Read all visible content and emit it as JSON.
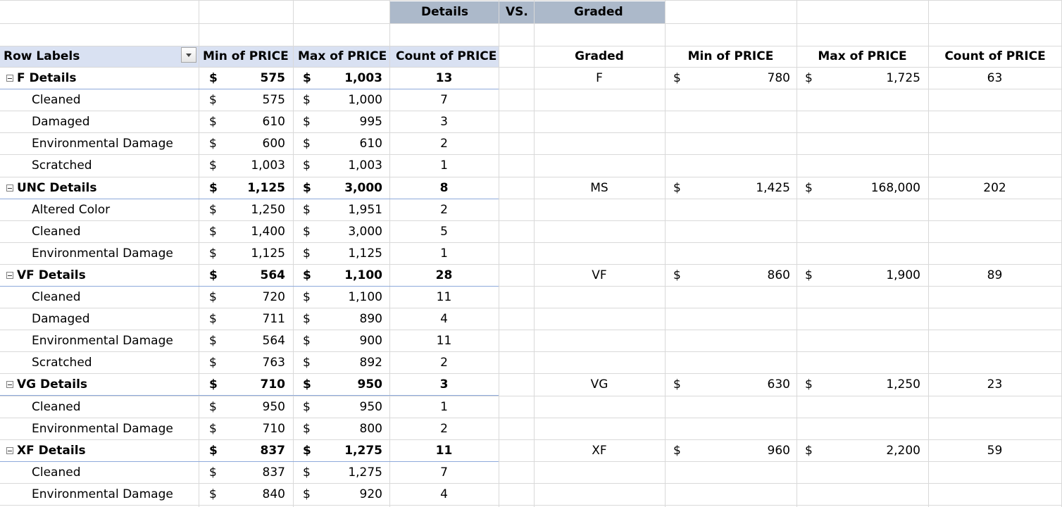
{
  "header": {
    "details": "Details",
    "vs": "VS.",
    "graded": "Graded"
  },
  "pivot_left": {
    "columns": [
      "Row Labels",
      "Min of PRICE",
      "Max of PRICE",
      "Count of PRICE"
    ],
    "currency": "$",
    "rows": [
      {
        "label": "F Details",
        "group": true,
        "min": "575",
        "max": "1,003",
        "count": "13"
      },
      {
        "label": "Cleaned",
        "group": false,
        "min": "575",
        "max": "1,000",
        "count": "7"
      },
      {
        "label": "Damaged",
        "group": false,
        "min": "610",
        "max": "995",
        "count": "3"
      },
      {
        "label": "Environmental Damage",
        "group": false,
        "min": "600",
        "max": "610",
        "count": "2"
      },
      {
        "label": "Scratched",
        "group": false,
        "min": "1,003",
        "max": "1,003",
        "count": "1"
      },
      {
        "label": "UNC Details",
        "group": true,
        "min": "1,125",
        "max": "3,000",
        "count": "8"
      },
      {
        "label": "Altered Color",
        "group": false,
        "min": "1,250",
        "max": "1,951",
        "count": "2"
      },
      {
        "label": "Cleaned",
        "group": false,
        "min": "1,400",
        "max": "3,000",
        "count": "5"
      },
      {
        "label": "Environmental Damage",
        "group": false,
        "min": "1,125",
        "max": "1,125",
        "count": "1"
      },
      {
        "label": "VF Details",
        "group": true,
        "min": "564",
        "max": "1,100",
        "count": "28"
      },
      {
        "label": "Cleaned",
        "group": false,
        "min": "720",
        "max": "1,100",
        "count": "11"
      },
      {
        "label": "Damaged",
        "group": false,
        "min": "711",
        "max": "890",
        "count": "4"
      },
      {
        "label": "Environmental Damage",
        "group": false,
        "min": "564",
        "max": "900",
        "count": "11"
      },
      {
        "label": "Scratched",
        "group": false,
        "min": "763",
        "max": "892",
        "count": "2"
      },
      {
        "label": "VG Details",
        "group": true,
        "min": "710",
        "max": "950",
        "count": "3"
      },
      {
        "label": "Cleaned",
        "group": false,
        "min": "950",
        "max": "950",
        "count": "1"
      },
      {
        "label": "Environmental Damage",
        "group": false,
        "min": "710",
        "max": "800",
        "count": "2"
      },
      {
        "label": "XF Details",
        "group": true,
        "min": "837",
        "max": "1,275",
        "count": "11"
      },
      {
        "label": "Cleaned",
        "group": false,
        "min": "837",
        "max": "1,275",
        "count": "7"
      },
      {
        "label": "Environmental Damage",
        "group": false,
        "min": "840",
        "max": "920",
        "count": "4"
      }
    ]
  },
  "graded_table": {
    "columns": [
      "Graded",
      "Min of PRICE",
      "Max of PRICE",
      "Count of PRICE"
    ],
    "currency": "$",
    "rows": [
      {
        "row": 0,
        "grade": "F",
        "min": "780",
        "max": "1,725",
        "count": "63"
      },
      {
        "row": 5,
        "grade": "MS",
        "min": "1,425",
        "max": "168,000",
        "count": "202"
      },
      {
        "row": 9,
        "grade": "VF",
        "min": "860",
        "max": "1,900",
        "count": "89"
      },
      {
        "row": 14,
        "grade": "VG",
        "min": "630",
        "max": "1,250",
        "count": "23"
      },
      {
        "row": 17,
        "grade": "XF",
        "min": "960",
        "max": "2,200",
        "count": "59"
      }
    ]
  },
  "colors": {
    "header_fill": "#acb9ca",
    "pivot_header_fill": "#d9e1f2",
    "gridline": "#d9d9d9",
    "group_border": "#8ea9db"
  }
}
